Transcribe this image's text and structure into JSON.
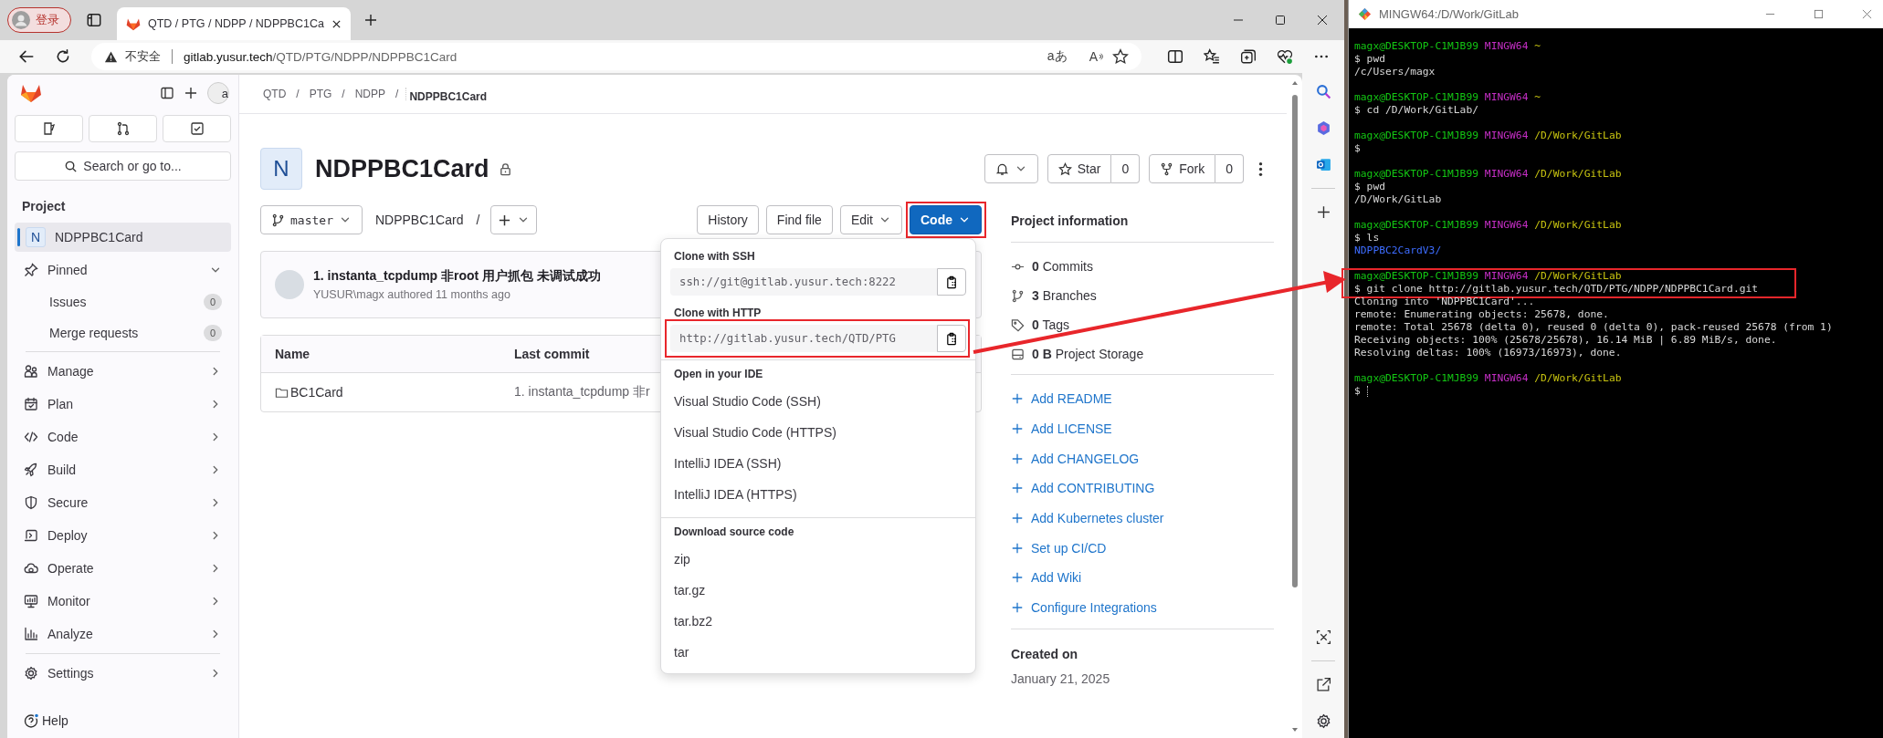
{
  "browser": {
    "profile_label": "登录",
    "tab_title": "QTD / PTG / NDPP / NDPPBC1Ca",
    "security_label": "不安全",
    "url_host": "gitlab.yusur.tech",
    "url_path": "/QTD/PTG/NDPP/NDPPBC1Card",
    "translate_glyph": "aあ",
    "read_aloud_glyph": "A"
  },
  "sidebar": {
    "avatar_alt": "a",
    "search_placeholder": "Search or go to...",
    "section_title": "Project",
    "project_item": {
      "initial": "N",
      "label": "NDPPBC1Card",
      "selected": true
    },
    "pinned": {
      "label": "Pinned",
      "expanded": true,
      "items": [
        {
          "label": "Issues",
          "count": "0"
        },
        {
          "label": "Merge requests",
          "count": "0"
        }
      ]
    },
    "menu": [
      {
        "label": "Manage"
      },
      {
        "label": "Plan"
      },
      {
        "label": "Code"
      },
      {
        "label": "Build"
      },
      {
        "label": "Secure"
      },
      {
        "label": "Deploy"
      },
      {
        "label": "Operate"
      },
      {
        "label": "Monitor"
      },
      {
        "label": "Analyze"
      }
    ],
    "settings": {
      "label": "Settings"
    },
    "help": {
      "label": "Help"
    }
  },
  "breadcrumbs": [
    {
      "label": "QTD",
      "current": false
    },
    {
      "separator": "/",
      "label": "PTG",
      "current": false
    },
    {
      "separator": "/",
      "label": "NDPP",
      "current": false
    },
    {
      "separator": "/",
      "label": "NDPPBC1Card",
      "current": true
    }
  ],
  "project": {
    "initial": "N",
    "name": "NDPPBC1Card",
    "private": true
  },
  "actions": {
    "star": {
      "label": "Star",
      "count": "0"
    },
    "fork": {
      "label": "Fork",
      "count": "0"
    }
  },
  "toolbar": {
    "branch": "master",
    "path": "NDPPBC1Card",
    "separator": "/",
    "buttons": [
      {
        "label": "History",
        "kind": "plain",
        "highlighted": false
      },
      {
        "label": "Find file",
        "kind": "plain",
        "highlighted": false
      },
      {
        "label": "Edit",
        "kind": "dropdown",
        "highlighted": false
      },
      {
        "label": "Code",
        "kind": "primary",
        "highlighted": true
      }
    ]
  },
  "commit": {
    "title": "1. instanta_tcpdump 非root 用户抓包 未调试成功",
    "meta": "YUSUR\\magx authored 11 months ago"
  },
  "files": {
    "columns": [
      "Name",
      "Last commit"
    ],
    "rows": [
      {
        "kind": "folder",
        "name": "BC1Card",
        "last_commit": "1. instanta_tcpdump 非r"
      }
    ]
  },
  "code_dropdown": {
    "clone": [
      {
        "title": "Clone with SSH",
        "url": "ssh://git@gitlab.yusur.tech:8222",
        "highlighted": false
      },
      {
        "title": "Clone with HTTP",
        "url": "http://gitlab.yusur.tech/QTD/PTG",
        "highlighted": true
      }
    ],
    "ide": {
      "title": "Open in your IDE",
      "items": [
        "Visual Studio Code (SSH)",
        "Visual Studio Code (HTTPS)",
        "IntelliJ IDEA (SSH)",
        "IntelliJ IDEA (HTTPS)"
      ]
    },
    "download": {
      "title": "Download source code",
      "items": [
        "zip",
        "tar.gz",
        "tar.bz2",
        "tar"
      ]
    }
  },
  "project_info": {
    "title": "Project information",
    "stats": [
      {
        "text": "**0** Commits"
      },
      {
        "text": "**3** Branches"
      },
      {
        "text": "**0** Tags"
      },
      {
        "text": "**0 B** Project Storage"
      }
    ],
    "links": [
      "Add README",
      "Add LICENSE",
      "Add CHANGELOG",
      "Add CONTRIBUTING",
      "Add Kubernetes cluster",
      "Set up CI/CD",
      "Add Wiki",
      "Configure Integrations"
    ],
    "created_label": "Created on",
    "created_date": "January 21, 2025"
  },
  "terminal": {
    "title": "MINGW64:/D/Work/GitLab",
    "lines": [
      {
        "kind": "prompt",
        "user": "magx@DESKTOP-C1MJB99",
        "host": "MINGW64",
        "path": "~"
      },
      {
        "kind": "text",
        "text": "$ pwd"
      },
      {
        "kind": "text",
        "text": "/c/Users/magx"
      },
      {
        "kind": "blank"
      },
      {
        "kind": "prompt",
        "user": "magx@DESKTOP-C1MJB99",
        "host": "MINGW64",
        "path": "~"
      },
      {
        "kind": "text",
        "text": "$ cd /D/Work/GitLab/"
      },
      {
        "kind": "blank"
      },
      {
        "kind": "prompt",
        "user": "magx@DESKTOP-C1MJB99",
        "host": "MINGW64",
        "path": "/D/Work/GitLab"
      },
      {
        "kind": "text",
        "text": "$"
      },
      {
        "kind": "blank"
      },
      {
        "kind": "prompt",
        "user": "magx@DESKTOP-C1MJB99",
        "host": "MINGW64",
        "path": "/D/Work/GitLab"
      },
      {
        "kind": "text",
        "text": "$ pwd"
      },
      {
        "kind": "text",
        "text": "/D/Work/GitLab"
      },
      {
        "kind": "blank"
      },
      {
        "kind": "prompt",
        "user": "magx@DESKTOP-C1MJB99",
        "host": "MINGW64",
        "path": "/D/Work/GitLab"
      },
      {
        "kind": "text",
        "text": "$ ls"
      },
      {
        "kind": "dir",
        "text": "NDPPBC2CardV3/"
      },
      {
        "kind": "blank"
      }
    ],
    "highlighted_lines": [
      {
        "kind": "prompt",
        "user": "magx@DESKTOP-C1MJB99",
        "host": "MINGW64",
        "path": "/D/Work/GitLab"
      },
      {
        "kind": "text",
        "text": "$ git clone http://gitlab.yusur.tech/QTD/PTG/NDPP/NDPPBC1Card.git"
      }
    ],
    "output_lines": [
      {
        "kind": "text",
        "text": "Cloning into 'NDPPBC1Card'..."
      },
      {
        "kind": "text",
        "text": "remote: Enumerating objects: 25678, done."
      },
      {
        "kind": "text",
        "text": "remote: Total 25678 (delta 0), reused 0 (delta 0), pack-reused 25678 (from 1)"
      },
      {
        "kind": "text",
        "text": "Receiving objects: 100% (25678/25678), 16.14 MiB | 6.89 MiB/s, done."
      },
      {
        "kind": "text",
        "text": "Resolving deltas: 100% (16973/16973), done."
      },
      {
        "kind": "blank"
      },
      {
        "kind": "prompt",
        "user": "magx@DESKTOP-C1MJB99",
        "host": "MINGW64",
        "path": "/D/Work/GitLab"
      },
      {
        "kind": "cursor",
        "text": "$"
      }
    ]
  }
}
